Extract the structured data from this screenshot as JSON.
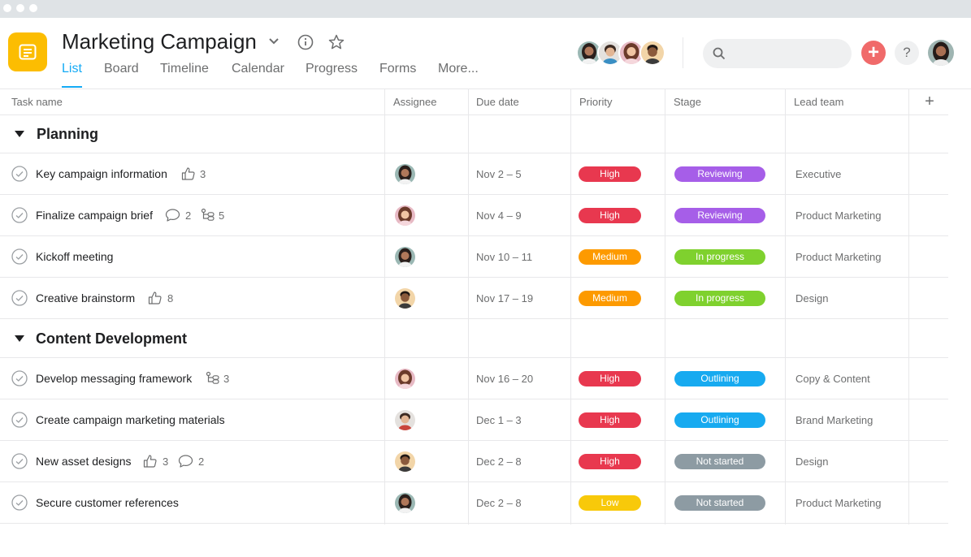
{
  "colors": {
    "accent": "#14aaf5",
    "app_icon": "#fcbd01",
    "add_button": "#f06a6a",
    "high": "#e8384f",
    "medium": "#fd9a00",
    "low": "#f8c90a",
    "reviewing": "#a65ee8",
    "in_progress": "#7fd12e",
    "outlining": "#17aaf0",
    "not_started": "#8d9ba3"
  },
  "project": {
    "title": "Marketing Campaign",
    "icon": "list-board-icon"
  },
  "tabs": [
    {
      "label": "List",
      "active": true
    },
    {
      "label": "Board",
      "active": false
    },
    {
      "label": "Timeline",
      "active": false
    },
    {
      "label": "Calendar",
      "active": false
    },
    {
      "label": "Progress",
      "active": false
    },
    {
      "label": "Forms",
      "active": false
    },
    {
      "label": "More...",
      "active": false
    }
  ],
  "header_actions": {
    "search_placeholder": "",
    "add_icon": "plus-icon",
    "help_label": "?"
  },
  "columns": {
    "task_name": "Task name",
    "assignee": "Assignee",
    "due_date": "Due date",
    "priority": "Priority",
    "stage": "Stage",
    "lead_team": "Lead team",
    "add": "+"
  },
  "sections": [
    {
      "title": "Planning",
      "tasks": [
        {
          "name": "Key campaign information",
          "likes": "3",
          "comments": null,
          "subtasks": null,
          "due": "Nov 2 – 5",
          "priority": "High",
          "stage": "Reviewing",
          "team": "Executive"
        },
        {
          "name": "Finalize campaign brief",
          "likes": null,
          "comments": "2",
          "subtasks": "5",
          "due": "Nov 4 – 9",
          "priority": "High",
          "stage": "Reviewing",
          "team": "Product Marketing"
        },
        {
          "name": "Kickoff meeting",
          "likes": null,
          "comments": null,
          "subtasks": null,
          "due": "Nov 10 – 11",
          "priority": "Medium",
          "stage": "In progress",
          "team": "Product Marketing"
        },
        {
          "name": "Creative brainstorm",
          "likes": "8",
          "comments": null,
          "subtasks": null,
          "due": "Nov 17 – 19",
          "priority": "Medium",
          "stage": "In progress",
          "team": "Design"
        }
      ]
    },
    {
      "title": "Content Development",
      "tasks": [
        {
          "name": "Develop messaging framework",
          "likes": null,
          "comments": null,
          "subtasks": "3",
          "due": "Nov 16 – 20",
          "priority": "High",
          "stage": "Outlining",
          "team": "Copy & Content"
        },
        {
          "name": "Create campaign marketing materials",
          "likes": null,
          "comments": null,
          "subtasks": null,
          "due": "Dec 1 – 3",
          "priority": "High",
          "stage": "Outlining",
          "team": "Brand Marketing"
        },
        {
          "name": "New asset designs",
          "likes": "3",
          "comments": "2",
          "subtasks": null,
          "due": "Dec 2 – 8",
          "priority": "High",
          "stage": "Not started",
          "team": "Design"
        },
        {
          "name": "Secure customer references",
          "likes": null,
          "comments": null,
          "subtasks": null,
          "due": "Dec 2 – 8",
          "priority": "Low",
          "stage": "Not started",
          "team": "Product Marketing"
        }
      ]
    }
  ]
}
